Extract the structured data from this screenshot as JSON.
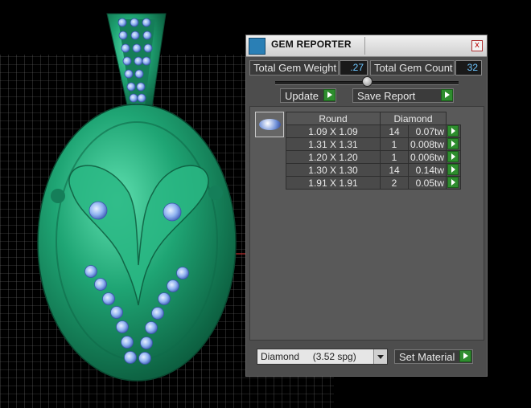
{
  "panel": {
    "title": "GEM REPORTER",
    "close_label": "x",
    "total_weight_label": "Total Gem Weight",
    "total_weight_value": ".27",
    "total_count_label": "Total Gem Count",
    "total_count_value": "32",
    "update_label": "Update",
    "save_report_label": "Save Report",
    "set_material_label": "Set Material",
    "material_value": "Diamond     (3.52 spg)"
  },
  "table": {
    "headers": [
      "Round",
      "Diamond"
    ],
    "rows": [
      {
        "size": "1.09 X 1.09",
        "count": "14",
        "weight": "0.07tw"
      },
      {
        "size": "1.31 X 1.31",
        "count": "1",
        "weight": "0.008tw"
      },
      {
        "size": "1.20 X 1.20",
        "count": "1",
        "weight": "0.006tw"
      },
      {
        "size": "1.30 X 1.30",
        "count": "14",
        "weight": "0.14tw"
      },
      {
        "size": "1.91 X 1.91",
        "count": "2",
        "weight": "0.05tw"
      }
    ]
  },
  "colors": {
    "metal": "#1f9e6e",
    "gem": "#8fb3f0",
    "grid": "#7a7a7a"
  },
  "icons": [
    "gem-reporter-icon",
    "close-icon",
    "play-arrow-icon",
    "gem-thumbnail",
    "dropdown-arrow-icon"
  ]
}
